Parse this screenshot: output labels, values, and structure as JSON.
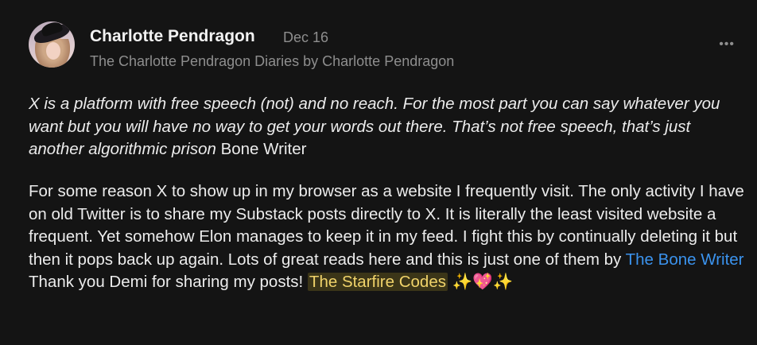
{
  "author": {
    "name": "Charlotte Pendragon",
    "date": "Dec 16",
    "publication": "The Charlotte Pendragon Diaries by Charlotte Pendragon"
  },
  "menu": {
    "more_label": "•••"
  },
  "note": {
    "quote_italic": "X is a platform with free speech (not) and no reach. For the most part you can say whatever you want but you will have no way to get your words out there. That’s not free speech, that’s just another algorithmic prison",
    "quote_attribution": " Bone Writer",
    "para_text_1": "For some reason X to show up in my browser as a website I frequently visit. The only activity I have on old Twitter is to share my Substack posts directly to X. It is literally the least visited website a frequent. Yet somehow Elon manages to keep it in my feed. I fight this by continually deleting it but then it pops back up again. Lots of great reads here and this is just one of them by ",
    "link_text": "The Bone Writer",
    "para_text_2": " Thank you Demi for sharing my posts! ",
    "highlight_text": "The Starfire Codes",
    "emoji_text": " ✨💖✨"
  },
  "colors": {
    "background": "#141414",
    "link": "#3b93ee",
    "highlight_bg": "#3b3518",
    "highlight_text": "#f0d36a",
    "muted": "#8e8e8e"
  }
}
